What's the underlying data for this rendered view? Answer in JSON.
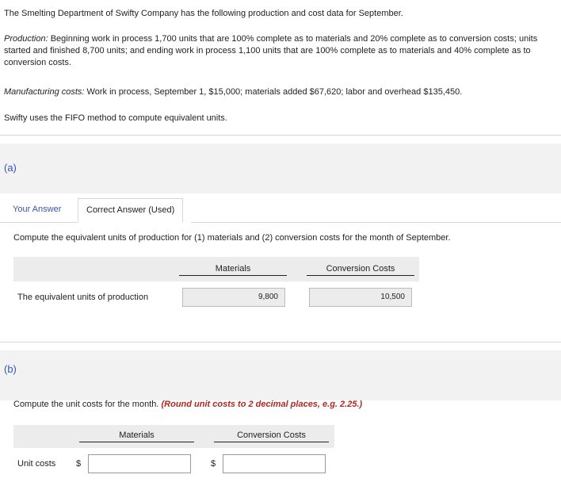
{
  "problem": {
    "intro": "The Smelting Department of Swifty Company has the following production and cost data for September.",
    "production_label": "Production:",
    "production_text": " Beginning work in process 1,700 units that are 100% complete as to materials and 20% complete as to conversion costs; units started and finished 8,700 units; and ending work in process 1,100 units that are 100% complete as to materials and 40% complete as to conversion costs.",
    "manufacturing_label": "Manufacturing costs:",
    "manufacturing_text": " Work in process, September 1, $15,000; materials added $67,620; labor and overhead $135,450.",
    "method": "Swifty uses the FIFO method to compute equivalent units."
  },
  "part_a": {
    "label": "(a)",
    "tabs": {
      "your_answer": "Your Answer",
      "correct_answer": "Correct Answer (Used)"
    },
    "instruction": "Compute the equivalent units of production for (1) materials and (2) conversion costs for the month of September.",
    "columns": {
      "materials": "Materials",
      "conversion": "Conversion Costs"
    },
    "row_label": "The equivalent units of production",
    "materials_value": "9,800",
    "conversion_value": "10,500"
  },
  "part_b": {
    "label": "(b)",
    "instruction": "Compute the unit costs for the month.",
    "hint": "(Round unit costs to 2 decimal places, e.g. 2.25.)",
    "columns": {
      "materials": "Materials",
      "conversion": "Conversion Costs"
    },
    "row_label": "Unit costs",
    "currency_symbol": "$",
    "materials_value": "",
    "conversion_value": ""
  }
}
